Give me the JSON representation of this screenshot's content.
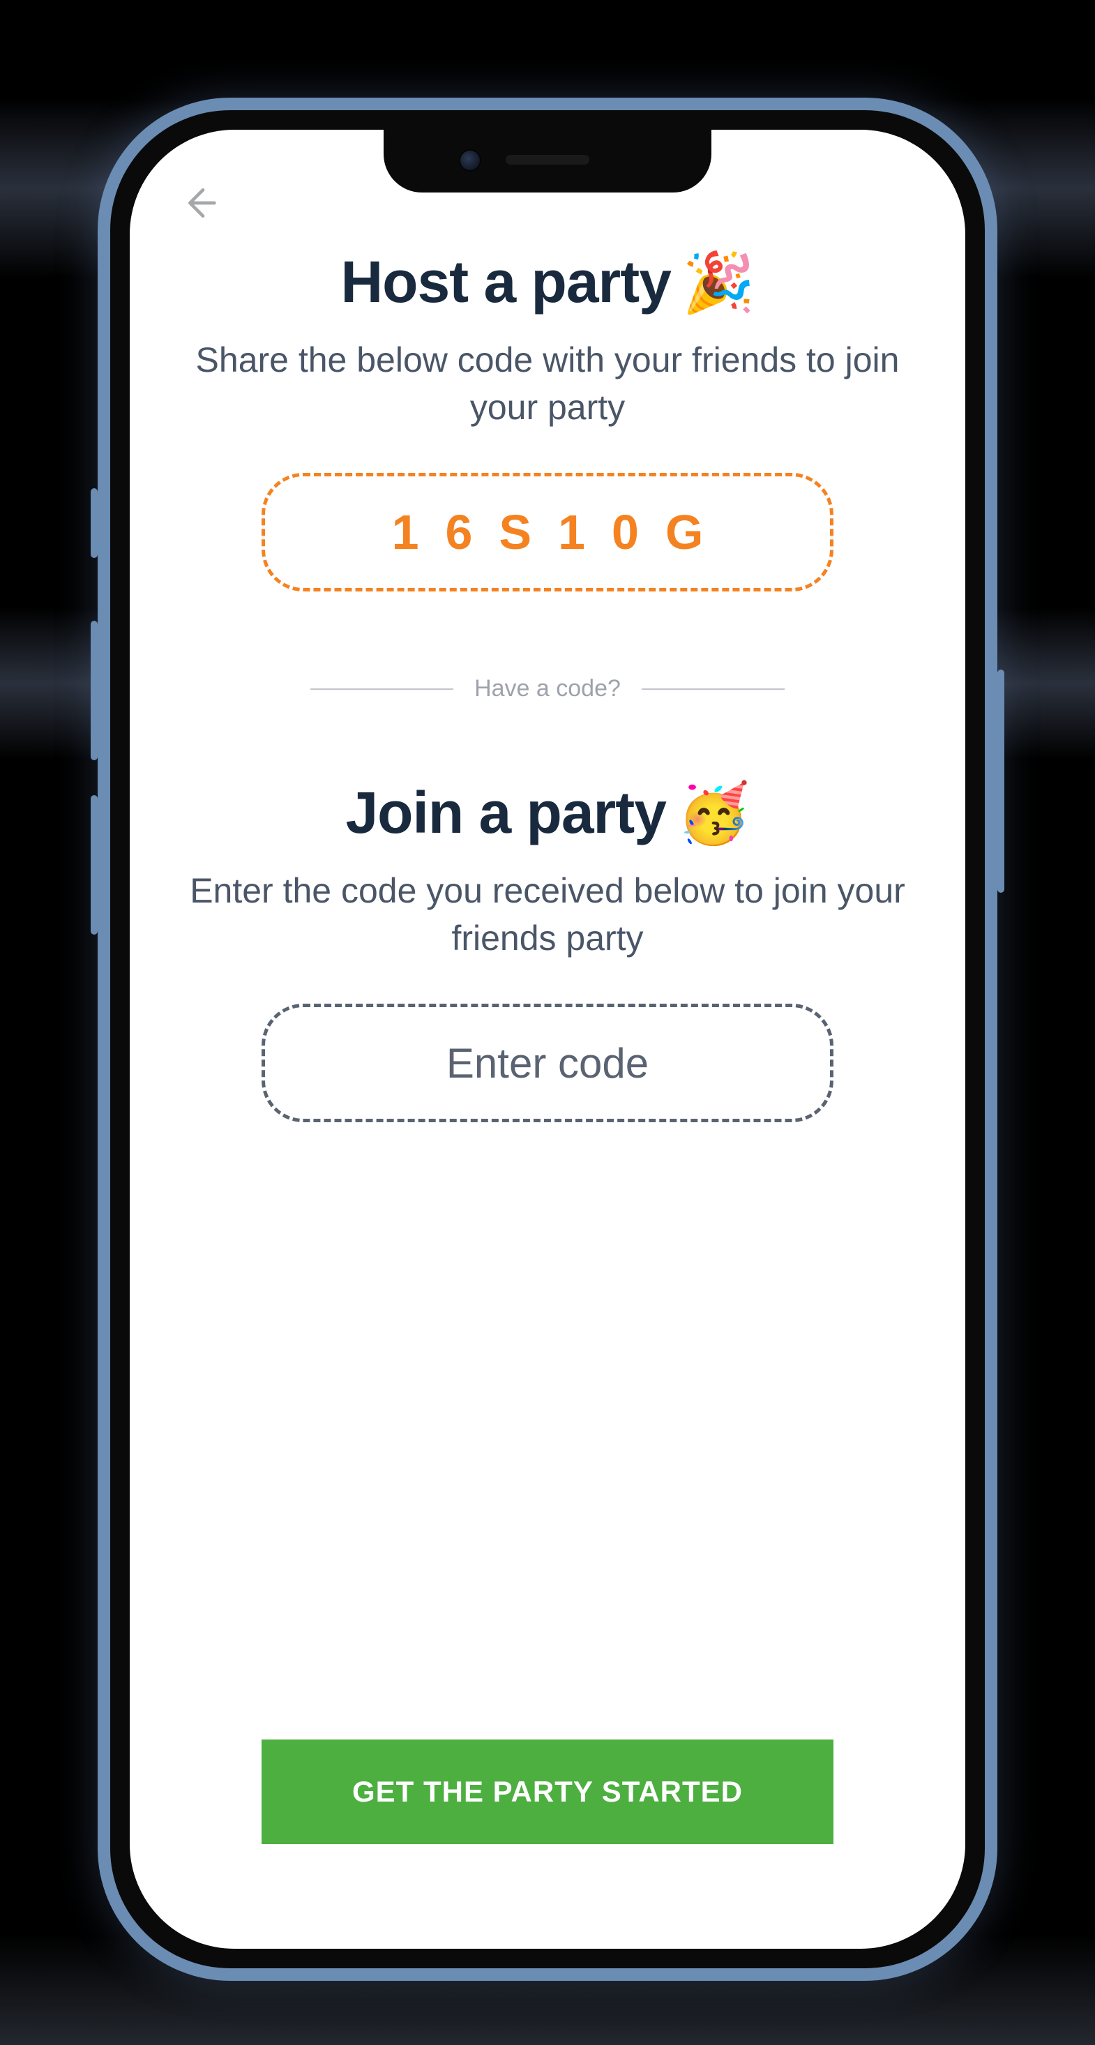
{
  "host": {
    "title": "Host a party",
    "emoji": "🎉",
    "subtitle": "Share the below code with your friends to join your party",
    "code": "16S10G"
  },
  "divider": {
    "label": "Have a code?"
  },
  "join": {
    "title": "Join a party",
    "emoji": "🥳",
    "subtitle": "Enter the code you received below to join your friends party",
    "placeholder": "Enter code"
  },
  "cta": {
    "label": "GET THE PARTY STARTED"
  },
  "colors": {
    "accent_orange": "#f58220",
    "cta_green": "#4caf3f",
    "heading": "#1a2a3e",
    "body": "#4a5668"
  }
}
